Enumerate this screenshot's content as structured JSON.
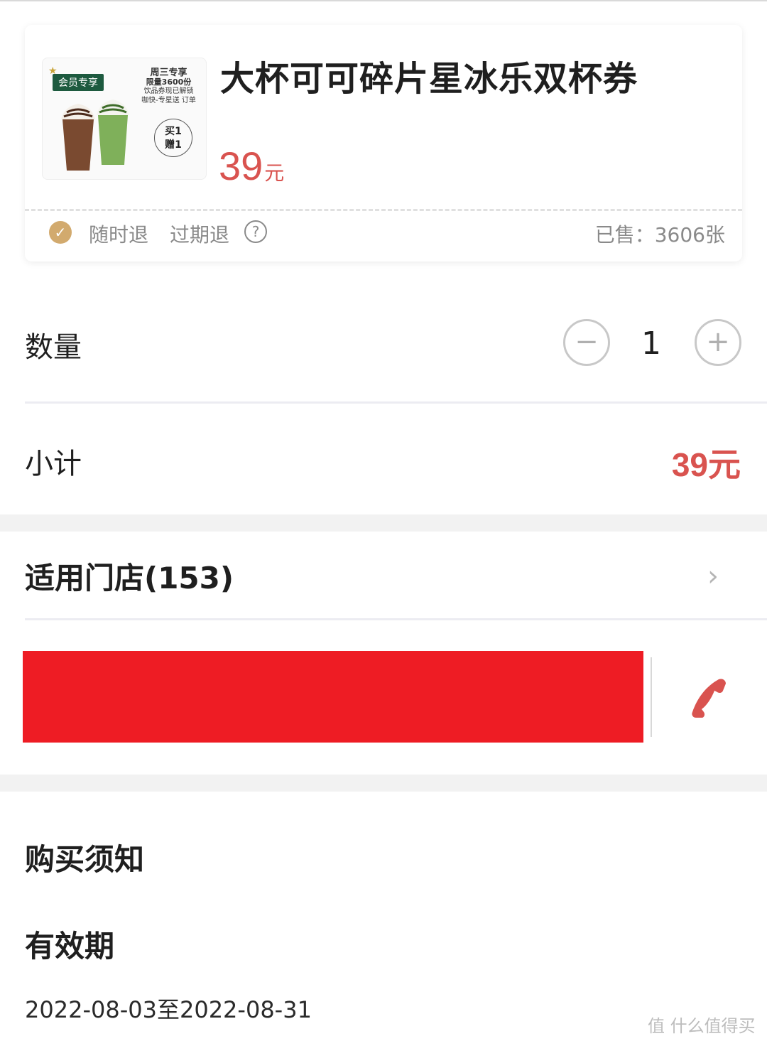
{
  "coupon": {
    "thumbnail": {
      "member_badge": "会员专享",
      "promo_line1": "周三专享",
      "promo_line2": "限量3600份",
      "promo_line3": "饮品券现已解锁",
      "promo_line4": "咖快-专星送 订单",
      "b1g1_line1": "买1",
      "b1g1_line2": "赠1"
    },
    "title": "大杯可可碎片星冰乐双杯券",
    "price_value": "39",
    "price_unit": "元",
    "tag_refund_anytime": "随时退",
    "tag_refund_expired": "过期退",
    "help_icon": "question-circle-icon",
    "sold_label": "已售：",
    "sold_count": "3606张"
  },
  "quantity": {
    "label": "数量",
    "value": "1",
    "minus": "−",
    "plus": "+"
  },
  "subtotal": {
    "label": "小计",
    "value": "39元"
  },
  "stores": {
    "label": "适用门店(153)",
    "chevron": "›",
    "phone_icon": "phone-icon"
  },
  "notice": {
    "title": "购买须知",
    "validity_title": "有效期",
    "validity_dates": "2022-08-03至2022-08-31"
  },
  "watermark": "值 什么值得买",
  "colors": {
    "price": "#d9534f",
    "redaction": "#ee1c24",
    "check_badge": "#d2aa6e",
    "member_badge": "#1d5a3f"
  }
}
